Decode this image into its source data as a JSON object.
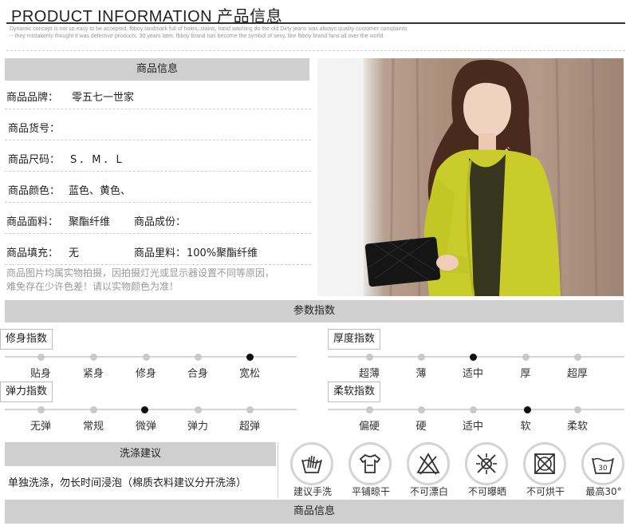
{
  "header": {
    "title": "PRODUCT INFORMATION 产品信息",
    "description": "Dynamic concept is not so easy to be accepted, fbboy landmark full of holes, stains, hand washing do the old Dirty jeans was always quality customer complaints -- they mistakenly thought it was defective products. 30 years later, fbboy brand has become the symbol of sexy, like fbboy brand fans all over the world."
  },
  "info": {
    "section_title": "商品信息",
    "brand_label": "商品品牌：",
    "brand_value": "零五七一世家",
    "sku_label": "商品货号：",
    "size_label": "商品尺码：",
    "size_value": "S．M．L",
    "color_label": "商品颜色：",
    "color_value": "蓝色、黄色、",
    "fabric_label": "商品面料：",
    "fabric_value": "聚酯纤维",
    "composition_label": "商品成份：",
    "filling_label": "商品填充：",
    "filling_value": "无",
    "lining_label": "商品里料：",
    "lining_value": "100%聚酯纤维",
    "note_line1": "商品图片均属实物拍摄，因拍摄灯光或显示器设置不同等原因，",
    "note_line2": "难免存在少许色差！请以实物颜色为准！"
  },
  "params": {
    "section_title": "参数指数",
    "scales": [
      {
        "name": "修身指数",
        "levels": [
          "贴身",
          "紧身",
          "修身",
          "合身",
          "宽松"
        ],
        "selected": 4
      },
      {
        "name": "厚度指数",
        "levels": [
          "超薄",
          "薄",
          "适中",
          "厚",
          "超厚"
        ],
        "selected": 2
      },
      {
        "name": "弹力指数",
        "levels": [
          "无弹",
          "常规",
          "微弹",
          "弹力",
          "超弹"
        ],
        "selected": 2
      },
      {
        "name": "柔软指数",
        "levels": [
          "偏硬",
          "硬",
          "适中",
          "软",
          "柔软"
        ],
        "selected": 3
      }
    ]
  },
  "wash": {
    "section_title": "洗涤建议",
    "advice": "单独洗涤，勿长时间浸泡（棉质衣料建议分开洗涤）",
    "icons": [
      {
        "icon": "hand-wash-icon",
        "label": "建议手洗"
      },
      {
        "icon": "flat-dry-icon",
        "label": "平铺晾干"
      },
      {
        "icon": "no-bleach-icon",
        "label": "不可漂白"
      },
      {
        "icon": "no-sun-icon",
        "label": "不可曝晒"
      },
      {
        "icon": "no-tumble-dry-icon",
        "label": "不可烘干"
      },
      {
        "icon": "max-30-wash-icon",
        "label": "最高30°",
        "temp": "30"
      }
    ]
  },
  "footer": {
    "section_title": "商品信息"
  }
}
